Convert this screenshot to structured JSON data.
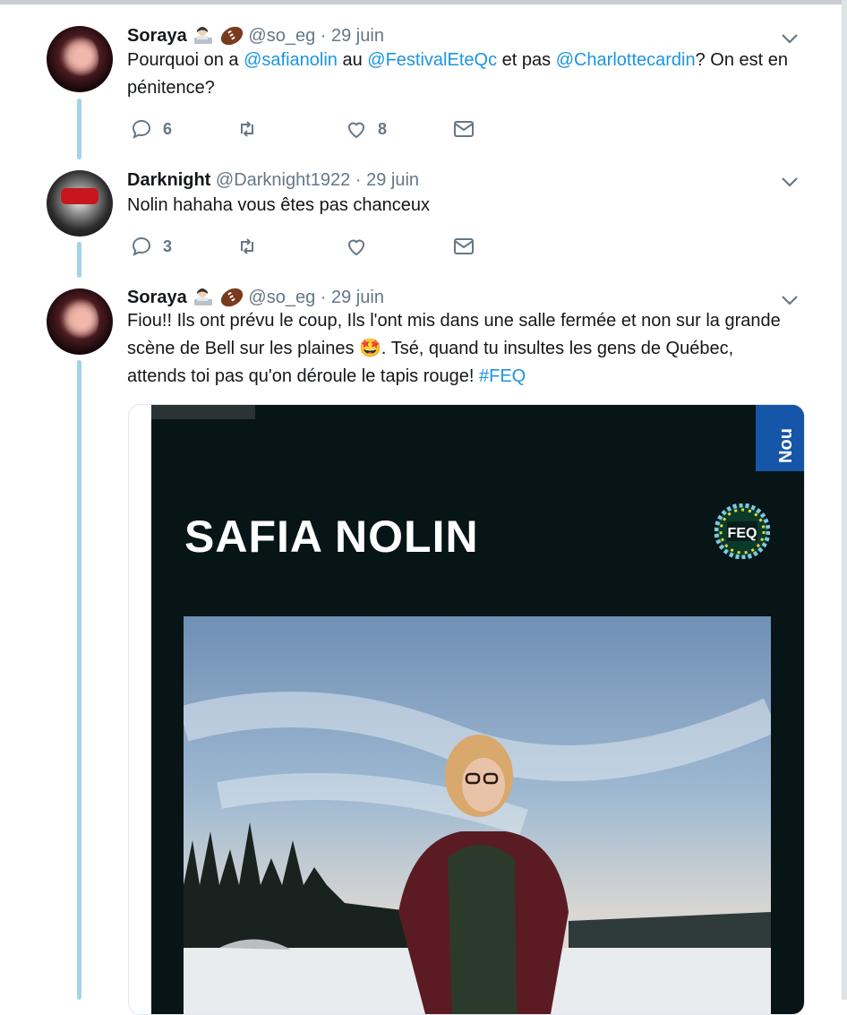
{
  "tweets": [
    {
      "name": "Soraya",
      "handle": "@so_eg",
      "sep": "·",
      "date": "29 juin",
      "text": [
        {
          "t": "Pourquoi on a "
        },
        {
          "t": "@safianolin",
          "link": true
        },
        {
          "t": " au "
        },
        {
          "t": "@FestivalEteQc",
          "link": true
        },
        {
          "t": " et pas "
        },
        {
          "t": "@Charlottecardin",
          "link": true
        },
        {
          "t": "? On est en pénitence?"
        }
      ],
      "replies": "6",
      "retweets": "",
      "likes": "8"
    },
    {
      "name": "Darknight",
      "handle": "@Darknight1922",
      "sep": "·",
      "date": "29 juin",
      "text": [
        {
          "t": "Nolin hahaha vous êtes pas chanceux"
        }
      ],
      "replies": "3",
      "retweets": "",
      "likes": ""
    },
    {
      "name": "Soraya",
      "handle": "@so_eg",
      "sep": "·",
      "date": "29 juin",
      "text": [
        {
          "t": "Fiou!! Ils ont prévu le coup, Ils l'ont mis dans une salle fermée et non sur la grande scène de Bell sur les plaines 🤩. Tsé, quand tu insultes les gens de Québec, attends toi pas qu'on déroule le tapis rouge! "
        },
        {
          "t": "#FEQ",
          "link": true
        }
      ]
    }
  ],
  "card": {
    "title": "SAFIA NOLIN",
    "tab": "Nou",
    "logo": "FEQ"
  },
  "icons": {
    "reply": "reply-icon",
    "retweet": "retweet-icon",
    "like": "heart-icon",
    "dm": "envelope-icon",
    "menu": "chevron-down-icon"
  },
  "colors": {
    "link": "#1b95e0",
    "thread": "#a3d3e6",
    "muted": "#657786"
  }
}
